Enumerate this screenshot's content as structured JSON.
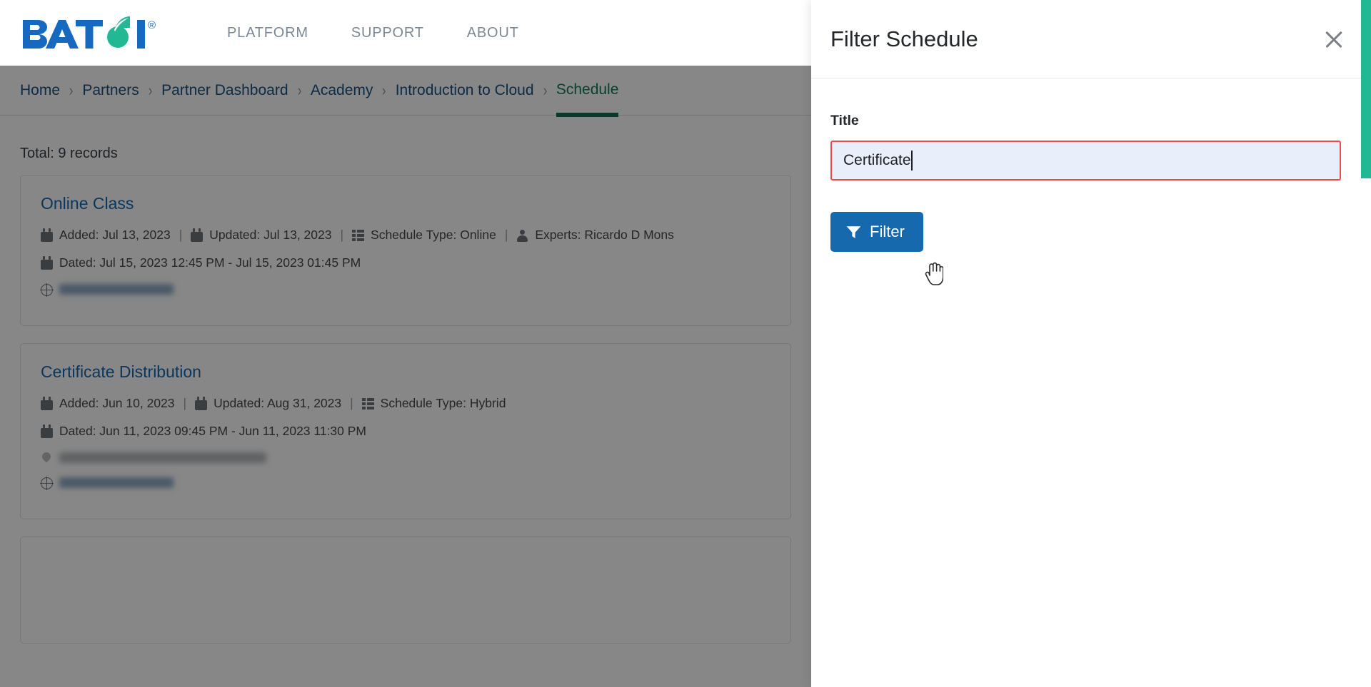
{
  "brand": {
    "name": "BATOI",
    "trademark": "®"
  },
  "nav": {
    "items": [
      {
        "label": "PLATFORM",
        "name": "nav-platform"
      },
      {
        "label": "SUPPORT",
        "name": "nav-support"
      },
      {
        "label": "ABOUT",
        "name": "nav-about"
      }
    ]
  },
  "breadcrumb": {
    "separator": "›",
    "items": [
      {
        "label": "Home",
        "active": false
      },
      {
        "label": "Partners",
        "active": false
      },
      {
        "label": "Partner Dashboard",
        "active": false
      },
      {
        "label": "Academy",
        "active": false
      },
      {
        "label": "Introduction to Cloud",
        "active": false
      },
      {
        "label": "Schedule",
        "active": true
      }
    ]
  },
  "main": {
    "total_label": "Total: 9 records",
    "cards": [
      {
        "title": "Online Class",
        "added_label": "Added: Jul 13, 2023",
        "updated_label": "Updated: Jul 13, 2023",
        "schedule_type_label": "Schedule Type: Online",
        "experts_label": "Experts: Ricardo D Mons",
        "dated_label": "Dated: Jul 15, 2023 12:45 PM - Jul 15, 2023 01:45 PM",
        "link_redacted": "shrouded-url",
        "location_redacted": null
      },
      {
        "title": "Certificate Distribution",
        "added_label": "Added: Jun 10, 2023",
        "updated_label": "Updated: Aug 31, 2023",
        "schedule_type_label": "Schedule Type: Hybrid",
        "experts_label": null,
        "dated_label": "Dated: Jun 11, 2023 09:45 PM - Jun 11, 2023 11:30 PM",
        "link_redacted": "shrouded-url",
        "location_redacted": "Conference Room, Batoi Head Office"
      }
    ]
  },
  "panel": {
    "title": "Filter Schedule",
    "close_icon": "close-icon",
    "field": {
      "label": "Title",
      "value": "Certificate",
      "placeholder": "Title"
    },
    "filter_button": {
      "label": "Filter",
      "icon": "funnel-icon"
    }
  },
  "colors": {
    "brand_blue": "#1668b0",
    "brand_teal": "#23b894",
    "accent_green": "#0f6e52",
    "button_blue": "#1669ac",
    "input_error_border": "#f0474a",
    "input_bg": "#e9eefb",
    "overlay": "rgba(0,0,0,0.47)"
  }
}
